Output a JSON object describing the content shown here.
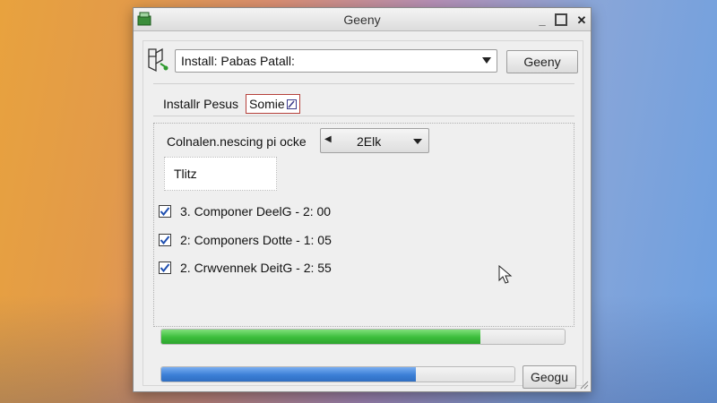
{
  "window": {
    "title": "Geeny",
    "controls": {
      "minimize": "_",
      "close": "✕"
    }
  },
  "toolbar": {
    "package_combo_value": "Install: Pabas Patall:",
    "action_button": "Geeny"
  },
  "install": {
    "label": "Installr Pesus",
    "tag": "Somie"
  },
  "connection": {
    "label": "Colnalen.nescing pi ocke",
    "spinner_value": "2Elk",
    "spinner_left": "◀"
  },
  "field": {
    "value": "Tlitz"
  },
  "components": [
    {
      "text": "3. Componer DeelG - 2: 00",
      "checked": true
    },
    {
      "text": "2: Componers Dotte - 1: 05",
      "checked": true
    },
    {
      "text": "2. Crwvennek DeitG - 2: 55",
      "checked": true
    }
  ],
  "progress": {
    "overall_fraction": 0.79,
    "current_fraction": 0.72,
    "colors": {
      "overall": "#3bbd3b",
      "current": "#3b7fd6"
    }
  },
  "footer": {
    "button": "Geogu"
  },
  "icons": [
    "app-icon",
    "package-icon",
    "tag-icon",
    "checkmark-icon",
    "resize-grip-icon"
  ]
}
